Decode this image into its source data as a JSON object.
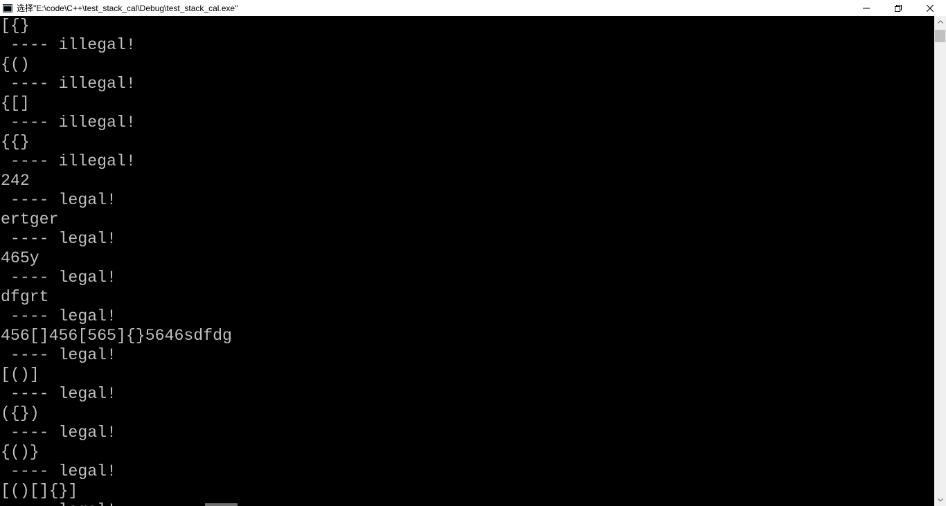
{
  "window": {
    "title": "选择\"E:\\code\\C++\\test_stack_cal\\Debug\\test_stack_cal.exe\"",
    "minimize_glyph": "—",
    "maximize_glyph": "❐",
    "close_glyph": "✕",
    "app_icon": "console-app-icon"
  },
  "console": {
    "lines": [
      "[{}",
      " ---- illegal!",
      "{()",
      " ---- illegal!",
      "{[]",
      " ---- illegal!",
      "{{}",
      " ---- illegal!",
      "242",
      " ---- legal!",
      "ertger",
      " ---- legal!",
      "465y",
      " ---- legal!",
      "dfgrt",
      " ---- legal!",
      "456[]456[565]{}5646sdfdg",
      " ---- legal!",
      "[()]",
      " ---- legal!",
      "({})",
      " ---- legal!",
      "{()}",
      " ---- legal!",
      "[()[]{}]",
      " ---- legal!"
    ]
  },
  "colors": {
    "console_bg": "#000000",
    "console_fg": "#c0c0c0",
    "titlebar_bg": "#ffffff",
    "scrollbar_bg": "#f0f0f0"
  }
}
